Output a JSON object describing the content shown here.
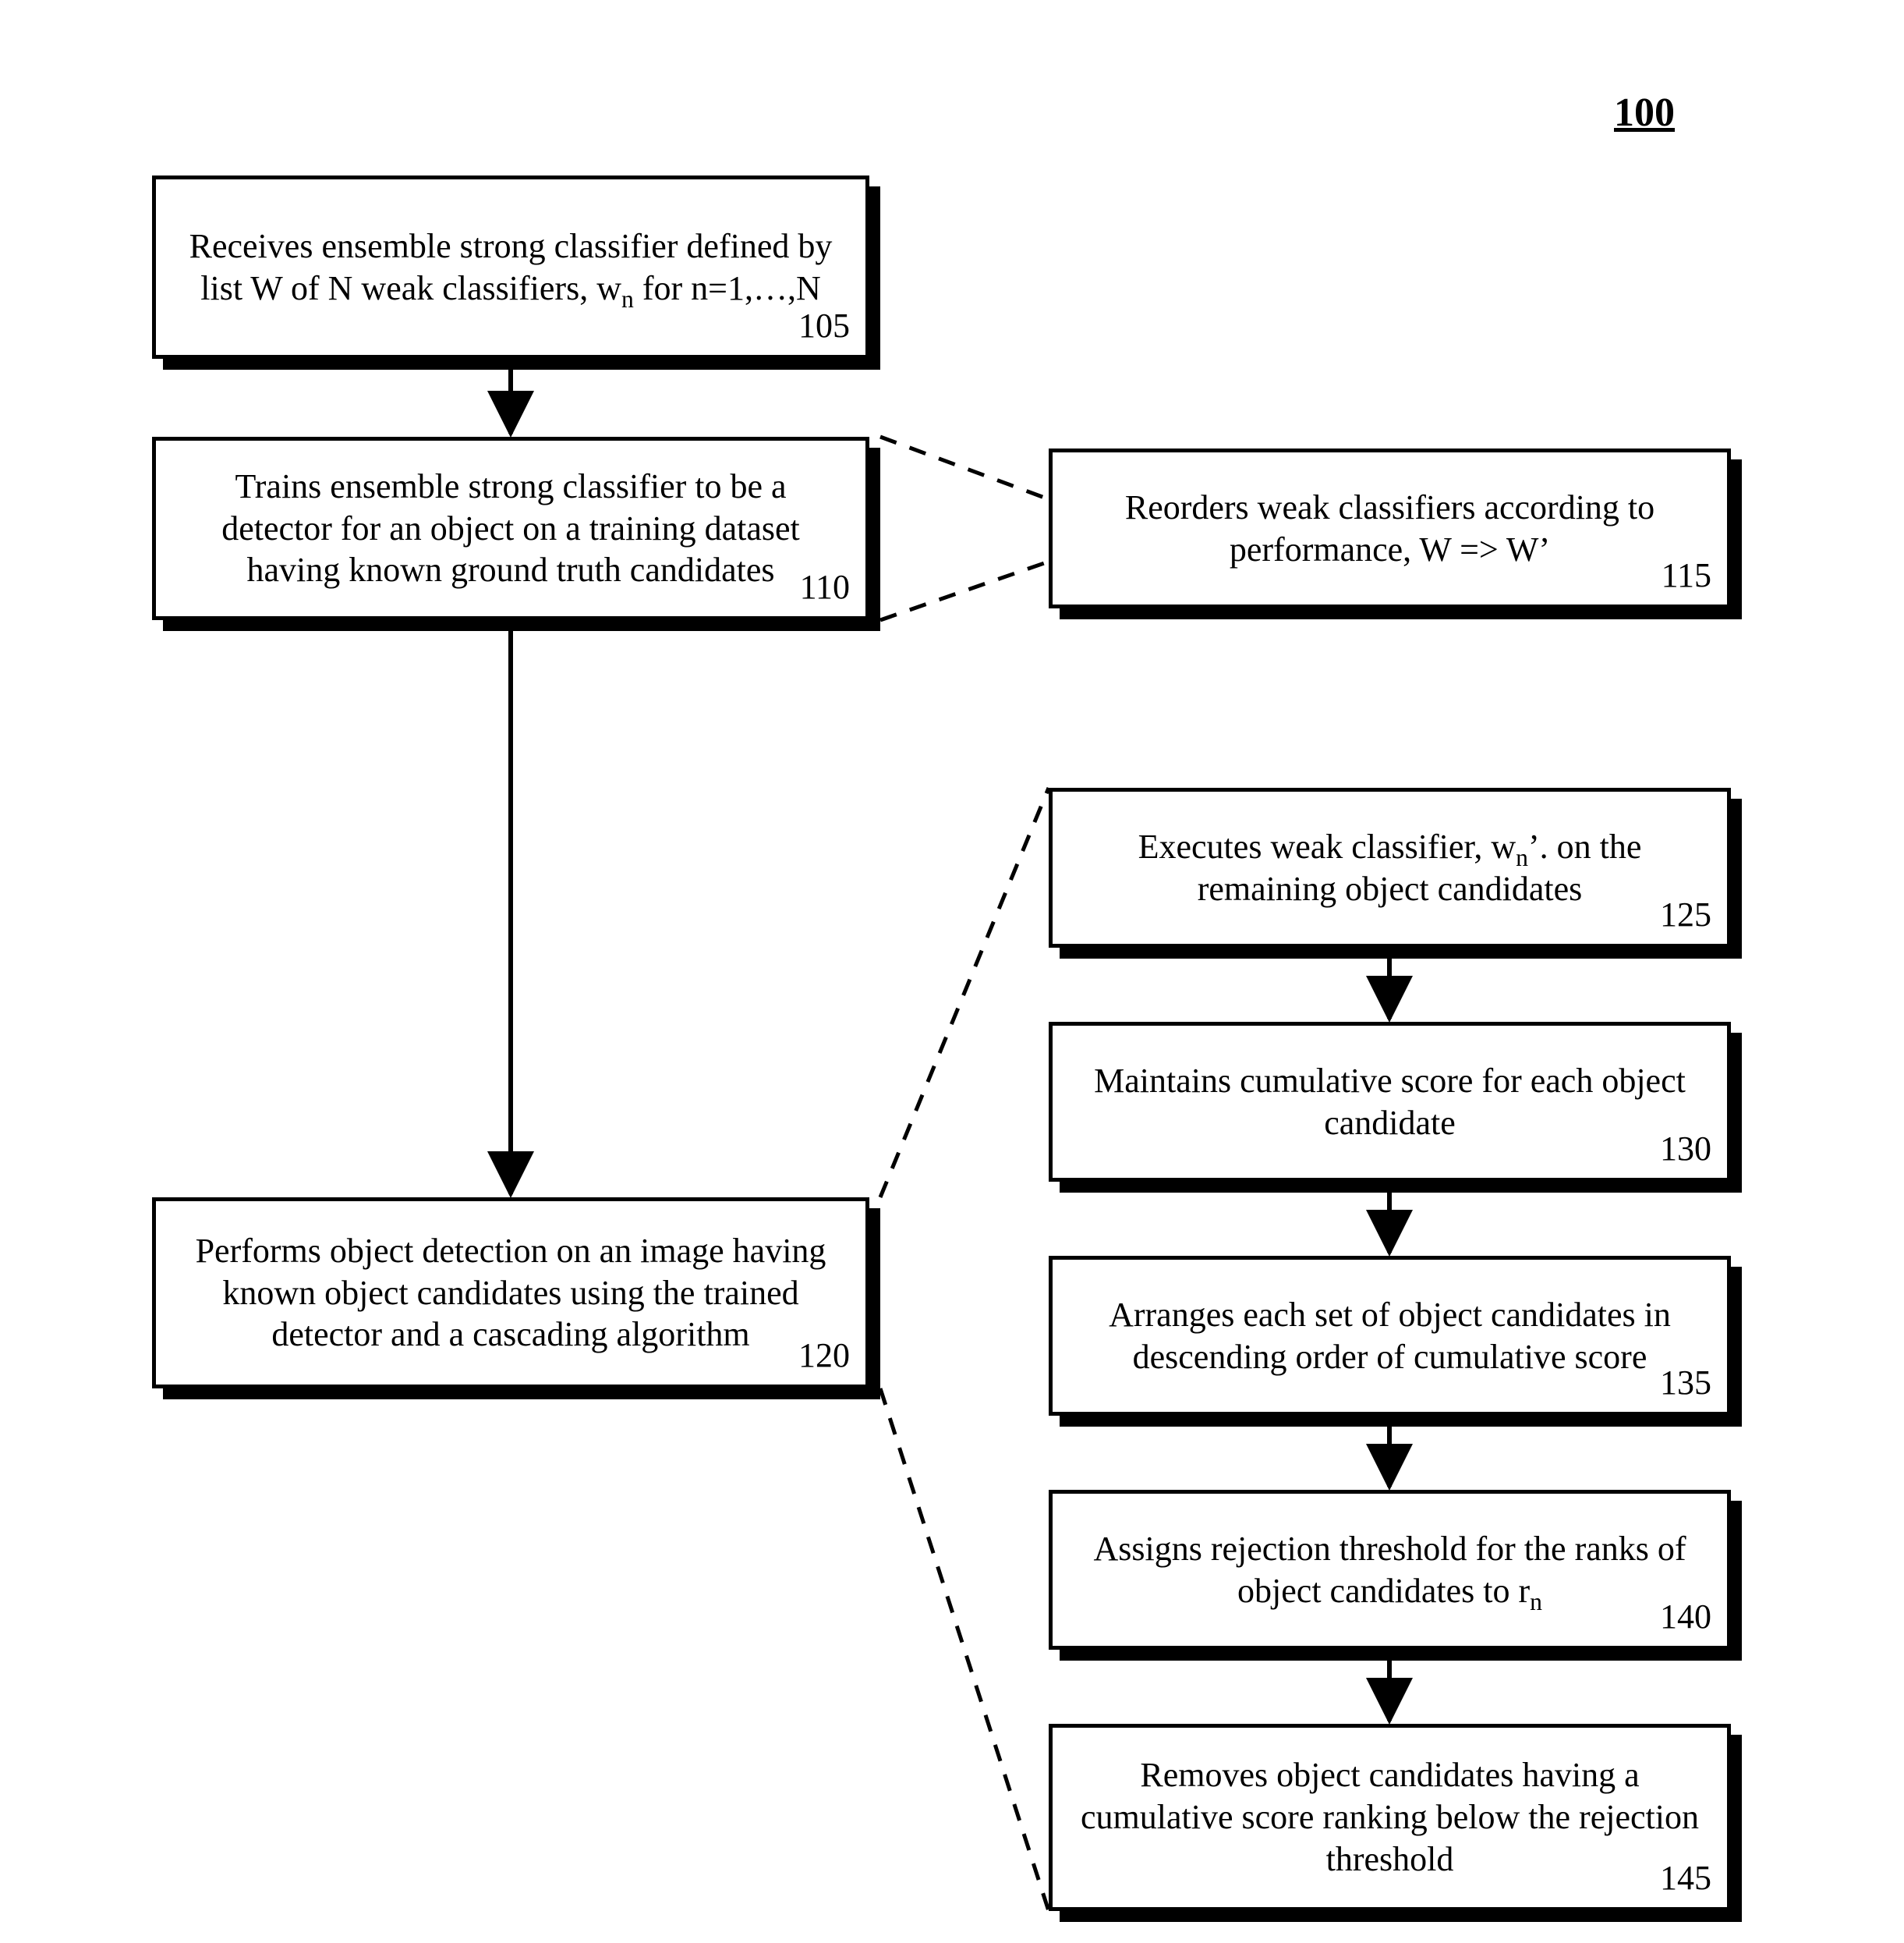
{
  "figure_number": "100",
  "boxes": {
    "b105": {
      "text": "Receives ensemble strong classifier defined by list W of N weak classifiers, w<sub>n</sub> for n=1,…,N",
      "num": "105"
    },
    "b110": {
      "text": "Trains ensemble strong classifier to be a detector for an object on a training dataset having known ground truth candidates",
      "num": "110"
    },
    "b115": {
      "text": "Reorders weak classifiers according to performance, W => W’",
      "num": "115"
    },
    "b120": {
      "text": "Performs object detection on an image having known object candidates using the trained detector and a cascading algorithm",
      "num": "120"
    },
    "b125": {
      "text": "Executes weak classifier, w<sub>n</sub>’. on the remaining object candidates",
      "num": "125"
    },
    "b130": {
      "text": "Maintains cumulative score for each object candidate",
      "num": "130"
    },
    "b135": {
      "text": "Arranges each set of object candidates in descending order of cumulative score",
      "num": "135"
    },
    "b140": {
      "text": "Assigns rejection threshold for the ranks of object candidates to r<sub>n</sub>",
      "num": "140"
    },
    "b145": {
      "text": "Removes object candidates having a cumulative score ranking below the rejection threshold",
      "num": "145"
    }
  }
}
